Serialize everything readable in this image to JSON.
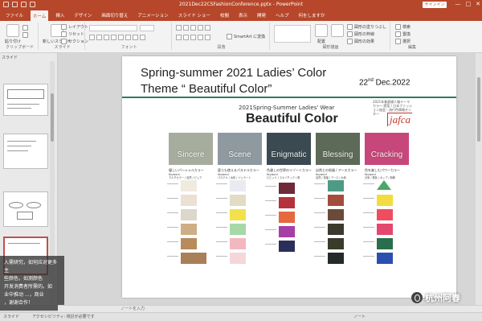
{
  "window": {
    "title": "2021Dec22CSFashionConference.pptx  -  PowerPoint",
    "signin": "サインイン",
    "controls": [
      "—",
      "□",
      "✕"
    ]
  },
  "ribbon_tabs": [
    "ファイル",
    "ホーム",
    "挿入",
    "デザイン",
    "画面切り替え",
    "アニメーション",
    "スライド ショー",
    "校閲",
    "表示",
    "開発",
    "ヘルプ",
    "何をしますか"
  ],
  "ribbon": {
    "clipboard": {
      "paste": "貼り付け",
      "label": "クリップボード"
    },
    "slides": {
      "new_slide": "新しいスライド",
      "layout": "レイアウト",
      "reset": "リセット",
      "section": "セクション",
      "label": "スライド"
    },
    "font": {
      "label": "フォント"
    },
    "paragraph": {
      "smartart": "SmartArt に変換",
      "label": "段落"
    },
    "drawing": {
      "label": "図形描画",
      "arrange": "配置",
      "quick_styles": "クイック スタイル",
      "fill": "図形の塗りつぶし",
      "outline": "図形の枠線",
      "effect": "図形の効果"
    },
    "editing": {
      "find": "検索",
      "replace": "置換",
      "select": "選択",
      "label": "編集"
    }
  },
  "thumb_pane": {
    "label": "スライド"
  },
  "subtitle_overlay": [
    "入需研究，如何应对更多主",
    "些颜色，如测颜色",
    "开发消费者所需的。如",
    "业中推动 ...，商业",
    "，谢谢合作！"
  ],
  "slide": {
    "title_line1": "Spring-summer 2021 Ladies’ Color",
    "title_line2": "Theme “ Beautiful Color”",
    "date_day": "22",
    "date_suffix": "nd",
    "date_rest": " Dec.2022",
    "poster": {
      "subtitle": "2021Spring-Summer Ladies' Wear",
      "heading": "Beautiful Color",
      "org_small": "2021年春夏婦人服テーマカラー 提案 / 日本ファッション協会・流行色情報センター",
      "logo": "jafca",
      "themes": [
        {
          "name": "Sincere",
          "jp": "優しいパーシャルカラー",
          "kw": [
            "Keyword",
            "マルチカラー / 自然 / ピュア"
          ],
          "bg": "#a7ad9d"
        },
        {
          "name": "Scene",
          "jp": "夏らも使えるパステルカラー",
          "kw": [
            "Keyword",
            "パステル / 淡彩 / ジェラート"
          ],
          "bg": "#8e9aa0"
        },
        {
          "name": "Enigmatic",
          "jp": "色違しの世界のリゾートカラー",
          "kw": [
            "Keyword",
            "ビビッド / エキゾチック / 夜"
          ],
          "bg": "#3a4a50"
        },
        {
          "name": "Blessing",
          "jp": "自然との祝福 / アースカラー",
          "kw": [
            "Keyword",
            "自然 / 祝福 / アース / 大地"
          ],
          "bg": "#5e6a58"
        },
        {
          "name": "Cracking",
          "jp": "色を楽しむパワーカラー",
          "kw": [
            "Keyword",
            "元気 / 発色 / ポップ / 新鮮"
          ],
          "bg": "#c8477a"
        }
      ],
      "swatches": [
        [
          "#f1eadf",
          "#eae1d2",
          "#ddd7cb",
          "#cfae86",
          "#b98a5c",
          "#a87f57"
        ],
        [
          "#eaeaf2",
          "#e2dcc5",
          "#f2e14a",
          "#a7d8a8",
          "#f2b8c1",
          "#f5d7d9"
        ],
        [
          "#6d2a37",
          "#b4323c",
          "#e6683f",
          "#a83ea5",
          "#2c2e5a"
        ],
        [
          "#4f9a86",
          "#a44d3c",
          "#6b4a3a",
          "#3c3a2d",
          "#3a3b2a",
          "#262a2a"
        ],
        [
          "#4aa865",
          "#f2dc3f",
          "#ef4d5f",
          "#e4476f",
          "#2a6e4d",
          "#2a4fb0"
        ]
      ]
    }
  },
  "notes_placeholder": "ノートを入力",
  "statusbar": {
    "slide_info": "スライド",
    "accessibility": "アクセシビリティ: 検討が必要です",
    "notes": "ノート"
  },
  "watermark": "杭州阿春"
}
